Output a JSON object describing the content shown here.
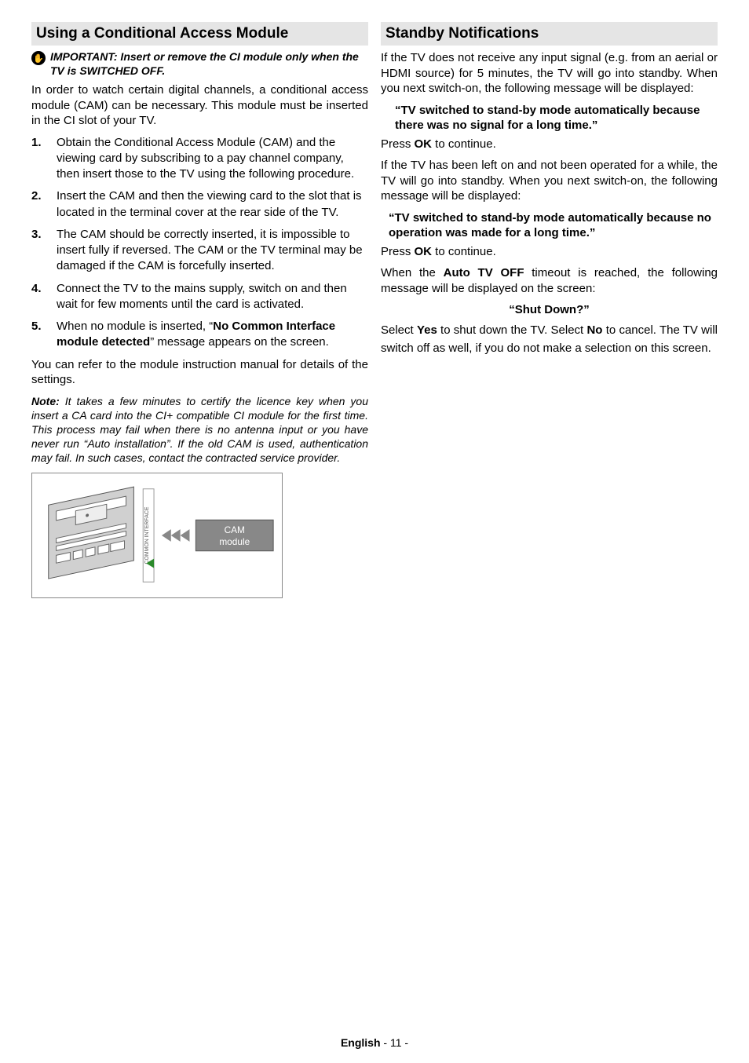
{
  "left": {
    "header": "Using a Conditional Access Module",
    "important": "IMPORTANT: Insert or remove the CI module only when the TV is SWITCHED OFF.",
    "intro": "In order to watch certain digital channels, a conditional access module (CAM) can be necessary. This module must be inserted in the CI slot of your TV.",
    "steps": [
      "Obtain the Conditional Access Module (CAM) and the viewing card by subscribing to a pay channel company, then insert those to the TV using the following procedure.",
      "Insert the CAM and then the viewing card to the slot that is located in the terminal cover at the rear side of the TV.",
      "The CAM should be correctly inserted, it is impossible to insert fully if reversed. The CAM or the TV terminal may be damaged if the CAM is forcefully inserted.",
      "Connect the TV to the mains supply, switch on and then wait for few moments until the card is activated.",
      "When no module is inserted, “No Common Interface module detected” message appears on the screen."
    ],
    "step5_prefix": "When no module is inserted, “",
    "step5_bold": "No Common Interface module detected",
    "step5_suffix": "” message appears on the screen.",
    "refer": "You can refer to the module instruction manual for details of the settings.",
    "note_label": "Note:",
    "note_body": " It takes a few minutes to certify the licence key when you insert a CA card into the CI+ compatible CI module for the first time. This process may fail when there is no antenna input or you have never run “Auto installation”. If the old CAM is used, authentication may fail. In such cases, contact the contracted service provider.",
    "diagram_slot_label": "COMMON INTERFACE",
    "diagram_cam_label1": "CAM",
    "diagram_cam_label2": "module"
  },
  "right": {
    "header": "Standby Notifications",
    "p1": "If the TV does not receive any input signal (e.g.  from an aerial or HDMI source) for 5 minutes, the TV will go into standby. When you next switch-on, the following message will be displayed:",
    "msg1": "“TV switched to stand-by mode automatically because there was no signal for a long time.”",
    "press_ok_prefix": "Press ",
    "press_ok_bold": "OK",
    "press_ok_suffix": " to continue.",
    "p2": "If the TV has been left on and not been operated for a while, the TV will go into standby. When you next switch-on, the following message will be displayed:",
    "msg2": "“TV switched to stand-by mode automatically because no operation was made for a long time.”",
    "auto_prefix": "When the ",
    "auto_bold": "Auto TV OFF",
    "auto_suffix": " timeout is reached, the following message will be displayed on the screen:",
    "msg3": "“Shut Down?”",
    "p3_prefix": "Select ",
    "p3_yes": "Yes",
    "p3_mid": " to shut down the TV. Select ",
    "p3_no": "No",
    "p3_suffix": " to cancel. The TV will switch off as well, if you do not make a selection on this screen."
  },
  "footer": {
    "lang": "English",
    "page": "   - 11 -"
  }
}
